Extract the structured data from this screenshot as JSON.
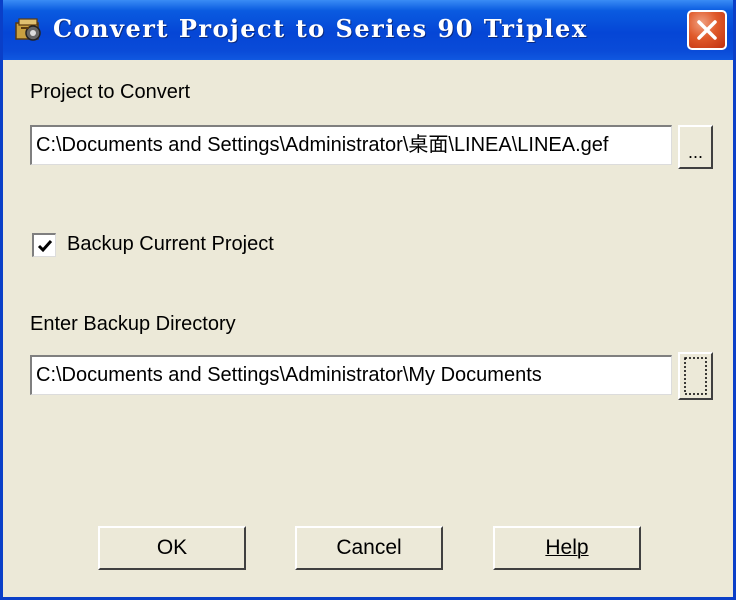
{
  "window": {
    "title": "Convert Project to Series 90 Triplex",
    "close_icon": "close-icon",
    "app_icon": "project-app-icon"
  },
  "project": {
    "label": "Project to Convert",
    "path": "C:\\Documents and Settings\\Administrator\\桌面\\LINEA\\LINEA.gef",
    "browse_label": "..."
  },
  "backup": {
    "checkbox_label": "Backup Current Project",
    "checked": true,
    "dir_label": "Enter Backup Directory",
    "dir_path": "C:\\Documents and Settings\\Administrator\\My Documents",
    "dir_button_icon": "folder-browse-icon"
  },
  "buttons": {
    "ok": "OK",
    "cancel": "Cancel",
    "help": "Help"
  }
}
